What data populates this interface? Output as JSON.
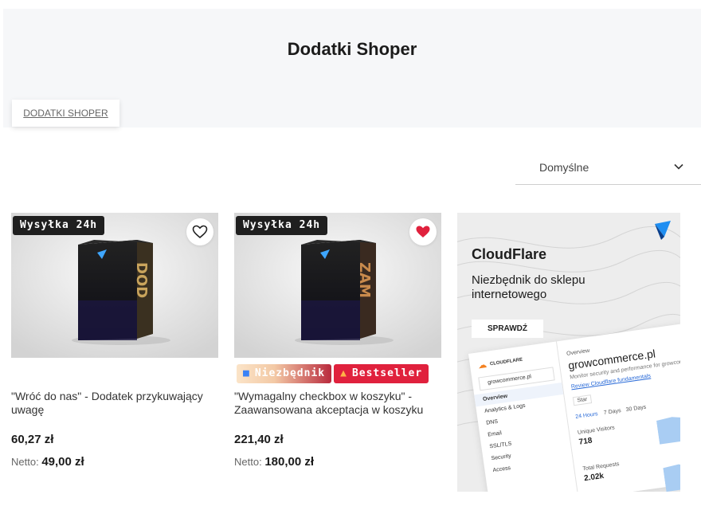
{
  "header": {
    "title": "Dodatki Shoper",
    "breadcrumb": "DODATKI SHOPER"
  },
  "sort": {
    "selected": "Domyślne"
  },
  "products": [
    {
      "badge": "Wysyłka 24h",
      "title": "\"Wróć do nas\" - Dodatek przykuwający uwagę",
      "price": "60,27 zł",
      "netto_label": "Netto:",
      "netto_value": "49,00 zł",
      "favorite": false,
      "box_text": "DOD"
    },
    {
      "badge": "Wysyłka 24h",
      "title": "\"Wymagalny checkbox w koszyku\" - Zaawansowana akceptacja w koszyku",
      "price": "221,40 zł",
      "netto_label": "Netto:",
      "netto_value": "180,00 zł",
      "favorite": true,
      "box_text": "ZAM",
      "tags": [
        "Niezbędnik",
        "Bestseller"
      ]
    }
  ],
  "banner": {
    "title": "CloudFlare",
    "subtitle": "Niezbędnik do sklepu internetowego",
    "button": "SPRAWDŹ",
    "dashboard": {
      "brand": "CLOUDFLARE",
      "site_select": "growcommerce.pl",
      "overview": "Overview",
      "site": "growcommerce.pl",
      "desc": "Monitor security and performance for growcommerce.pl",
      "review": "Review Cloudflare fundamentals",
      "star": "Star",
      "range": [
        "24 Hours",
        "7 Days",
        "30 Days"
      ],
      "menu": [
        "Overview",
        "Analytics & Logs",
        "DNS",
        "Email",
        "SSL/TLS",
        "Security",
        "Access"
      ],
      "unique_visitors_label": "Unique Visitors",
      "unique_visitors": "718",
      "total_requests_label": "Total Requests",
      "total_requests": "2.02k"
    }
  },
  "colors": {
    "accent_red": "#e0213d",
    "dark": "#1f1f1f",
    "hero_bg": "#f6f7f9"
  }
}
